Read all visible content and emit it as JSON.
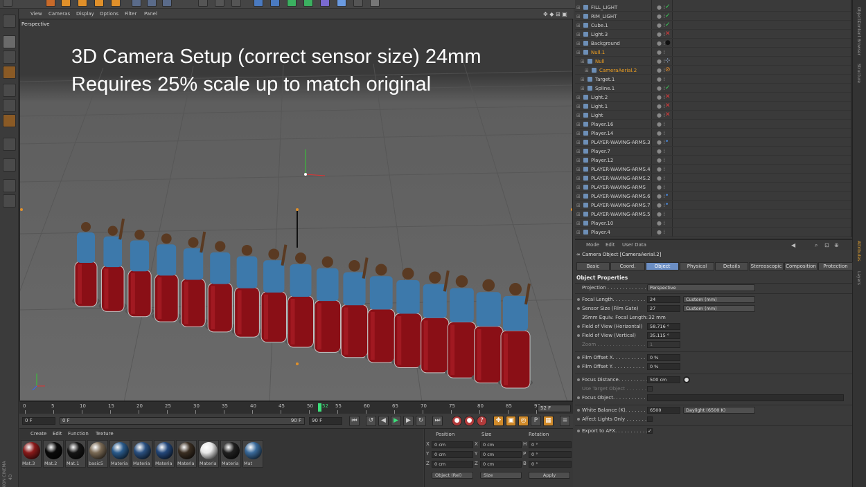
{
  "viewport": {
    "menu": [
      "View",
      "Cameras",
      "Display",
      "Options",
      "Filter",
      "Panel"
    ],
    "label": "Perspective",
    "overlay_line1": "3D Camera Setup (correct sensor size) 24mm",
    "overlay_line2": "Requires 25% scale up to match original"
  },
  "timeline": {
    "ticks": [
      "0",
      "5",
      "10",
      "15",
      "20",
      "25",
      "30",
      "35",
      "40",
      "45",
      "50",
      "55",
      "60",
      "65",
      "70",
      "75",
      "80",
      "85",
      "90"
    ],
    "current": "52",
    "end_label": "52 F"
  },
  "transport": {
    "start_field": "0 F",
    "slider_start": "0 F",
    "slider_end": "90 F",
    "end_field": "90 F"
  },
  "materials": {
    "menu": [
      "Create",
      "Edit",
      "Function",
      "Texture"
    ],
    "items": [
      {
        "label": "Mat.3",
        "color": "#8a1a1a"
      },
      {
        "label": "Mat.2",
        "color": "#0a0a0a"
      },
      {
        "label": "Mat.1",
        "color": "#151515"
      },
      {
        "label": "basic5",
        "color": "#7a6a55"
      },
      {
        "label": "Materia",
        "color": "#2a5a8a"
      },
      {
        "label": "Materia",
        "color": "#2a5080"
      },
      {
        "label": "Materia",
        "color": "#23477a"
      },
      {
        "label": "Materia",
        "color": "#3a2e22"
      },
      {
        "label": "Materia",
        "color": "#e8e8e8"
      },
      {
        "label": "Materia",
        "color": "#202020"
      },
      {
        "label": "Mat",
        "color": "#3a6a9a"
      }
    ]
  },
  "coords": {
    "headers": [
      "Position",
      "Size",
      "Rotation"
    ],
    "rows": [
      {
        "axis": "X",
        "pos": "0 cm",
        "size_axis": "X",
        "size": "0 cm",
        "rot_axis": "H",
        "rot": "0 °"
      },
      {
        "axis": "Y",
        "pos": "0 cm",
        "size_axis": "Y",
        "size": "0 cm",
        "rot_axis": "P",
        "rot": "0 °"
      },
      {
        "axis": "Z",
        "pos": "0 cm",
        "size_axis": "Z",
        "size": "0 cm",
        "rot_axis": "B",
        "rot": "0 °"
      }
    ],
    "mode_select": "Object (Rel)",
    "size_select": "Size",
    "apply_label": "Apply"
  },
  "objects": [
    {
      "name": "FILL_LIGHT",
      "indent": 0,
      "tag": "✓",
      "tagcolor": "#3bd15a"
    },
    {
      "name": "RIM_LIGHT",
      "indent": 0,
      "tag": "✓",
      "tagcolor": "#3bd15a"
    },
    {
      "name": "Cube.1",
      "indent": 0,
      "tag": "✓",
      "tagcolor": "#3bd15a"
    },
    {
      "name": "Light.3",
      "indent": 0,
      "tag": "✕",
      "tagcolor": "#e03a3a"
    },
    {
      "name": "Background",
      "indent": 0,
      "tag": "●",
      "tagcolor": "#111111"
    },
    {
      "name": "Null.1",
      "indent": 0,
      "tag": "",
      "tagcolor": "#888",
      "selected": true
    },
    {
      "name": "Null",
      "indent": 1,
      "tag": "⊹",
      "tagcolor": "#9ab0d0",
      "selected": true
    },
    {
      "name": "CameraAerial.2",
      "indent": 2,
      "tag": "⊘",
      "tagcolor": "#e08a2a",
      "selected": true
    },
    {
      "name": "Target.1",
      "indent": 1,
      "tag": "",
      "tagcolor": "#888"
    },
    {
      "name": "Spline.1",
      "indent": 1,
      "tag": "✓",
      "tagcolor": "#3bd15a"
    },
    {
      "name": "Light.2",
      "indent": 0,
      "tag": "✕",
      "tagcolor": "#e03a3a"
    },
    {
      "name": "Light.1",
      "indent": 0,
      "tag": "✕",
      "tagcolor": "#e03a3a"
    },
    {
      "name": "Light",
      "indent": 0,
      "tag": "✕",
      "tagcolor": "#e03a3a"
    },
    {
      "name": "Player.16",
      "indent": 0,
      "tag": "",
      "tagcolor": "#888"
    },
    {
      "name": "Player.14",
      "indent": 0,
      "tag": "",
      "tagcolor": "#888"
    },
    {
      "name": "PLAYER-WAVING-ARMS.3",
      "indent": 0,
      "tag": "•",
      "tagcolor": "#4a8ae0"
    },
    {
      "name": "Player.7",
      "indent": 0,
      "tag": "",
      "tagcolor": "#888"
    },
    {
      "name": "Player.12",
      "indent": 0,
      "tag": "",
      "tagcolor": "#888"
    },
    {
      "name": "PLAYER-WAVING-ARMS.4",
      "indent": 0,
      "tag": "",
      "tagcolor": "#888"
    },
    {
      "name": "PLAYER-WAVING-ARMS.2",
      "indent": 0,
      "tag": "",
      "tagcolor": "#888"
    },
    {
      "name": "PLAYER-WAVING-ARMS",
      "indent": 0,
      "tag": "",
      "tagcolor": "#888"
    },
    {
      "name": "PLAYER-WAVING-ARMS.6",
      "indent": 0,
      "tag": "•",
      "tagcolor": "#4a8ae0"
    },
    {
      "name": "PLAYER-WAVING-ARMS.7",
      "indent": 0,
      "tag": "•",
      "tagcolor": "#4a8ae0"
    },
    {
      "name": "PLAYER-WAVING-ARMS.5",
      "indent": 0,
      "tag": "",
      "tagcolor": "#888"
    },
    {
      "name": "Player.10",
      "indent": 0,
      "tag": "",
      "tagcolor": "#888"
    },
    {
      "name": "Player.4",
      "indent": 0,
      "tag": "",
      "tagcolor": "#888"
    }
  ],
  "attributes": {
    "menu": [
      "Mode",
      "Edit",
      "User Data"
    ],
    "title": "Camera Object [CameraAerial.2]",
    "tabs": [
      "Basic",
      "Coord.",
      "Object",
      "Physical",
      "Details",
      "Stereoscopic",
      "Composition",
      "Protection"
    ],
    "active_tab": "Object",
    "section": "Object Properties",
    "projection_label": "Projection . . . . . . . . . . . . . . .",
    "projection_value": "Perspective",
    "focal_label": "Focal Length. . . . . . . . . . .",
    "focal_value": "24",
    "focal_preset": "Custom (mm)",
    "sensor_label": "Sensor Size (Film Gate)",
    "sensor_value": "27",
    "sensor_preset": "Custom (mm)",
    "equiv_label": "35mm Equiv. Focal Length:",
    "equiv_value": "32 mm",
    "fovh_label": "Field of View (Horizontal)",
    "fovh_value": "58.716 °",
    "fovv_label": "Field of View (Vertical)",
    "fovv_value": "35.115 °",
    "zoom_label": "Zoom . . . . . . . . . . . . . . . .",
    "zoom_value": "1",
    "offx_label": "Film Offset X. . . . . . . . . . .",
    "offx_value": "0 %",
    "offy_label": "Film Offset Y. . . . . . . . . . .",
    "offy_value": "0 %",
    "focusdist_label": "Focus Distance. . . . . . . . . .",
    "focusdist_value": "500 cm",
    "usetarget_label": "Use Target Object . . . . . . .",
    "focusobj_label": "Focus Object. . . . . . . . . . . .",
    "wb_label": "White Balance (K). . . . . . . .",
    "wb_value": "6500",
    "wb_preset": "Daylight (6500 K)",
    "affect_label": "Affect Lights Only . . . . . . .",
    "export_label": "Export to AFX. . . . . . . . . . .",
    "export_check": "✓"
  },
  "right_strip": [
    "Objects",
    "Content Browser",
    "Structure",
    "Attributes",
    "Layers"
  ]
}
